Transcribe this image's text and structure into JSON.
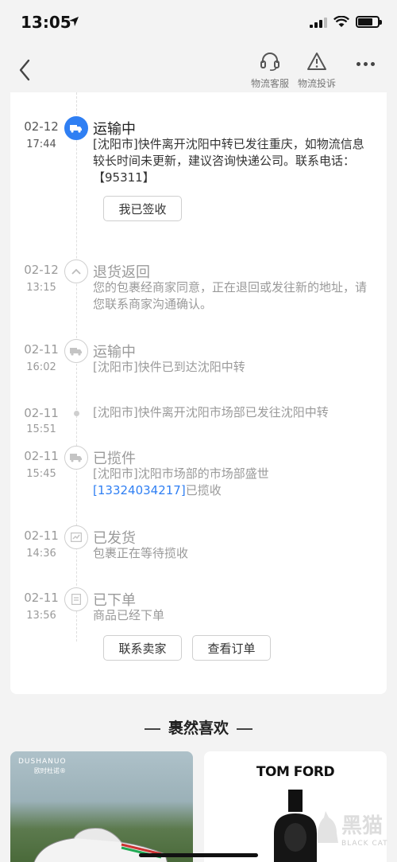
{
  "status_bar": {
    "time": "13:05"
  },
  "header": {
    "service_label": "物流客服",
    "complaint_label": "物流投诉"
  },
  "timeline": [
    {
      "date": "02-12",
      "time": "17:44",
      "status": "运输中",
      "desc": "[沈阳市]快件离开沈阳中转已发往重庆，如物流信息较长时间未更新，建议咨询快递公司。联系电话：【95311】",
      "icon": "truck-icon"
    },
    {
      "date": "02-12",
      "time": "13:15",
      "status": "退货返回",
      "desc": "您的包裹经商家同意，正在退回或发往新的地址，请您联系商家沟通确认。",
      "icon": "return-icon"
    },
    {
      "date": "02-11",
      "time": "16:02",
      "status": "运输中",
      "desc": "[沈阳市]快件已到达沈阳中转",
      "icon": "truck-icon"
    },
    {
      "date": "02-11",
      "time": "15:51",
      "status": "",
      "desc": "[沈阳市]快件离开沈阳市场部已发往沈阳中转",
      "icon": "dot"
    },
    {
      "date": "02-11",
      "time": "15:45",
      "status": "已揽件",
      "desc_prefix": "[沈阳市]沈阳市场部的市场部盛世",
      "phone": "[13324034217]",
      "desc_suffix": "已揽收",
      "icon": "pickup-icon"
    },
    {
      "date": "02-11",
      "time": "14:36",
      "status": "已发货",
      "desc": "包裹正在等待揽收",
      "icon": "shipped-icon"
    },
    {
      "date": "02-11",
      "time": "13:56",
      "status": "已下单",
      "desc": "商品已经下单",
      "icon": "order-icon"
    }
  ],
  "buttons": {
    "signed": "我已签收",
    "contact_seller": "联系卖家",
    "view_order": "查看订单"
  },
  "recommend": {
    "title": "裹然喜欢",
    "product1_brand": "DUSHANUO",
    "product1_brand_cn": "欧时杜诺®",
    "product2_brand": "TOM FORD"
  },
  "watermark": {
    "cn": "黑猫",
    "en": "BLACK CAT"
  },
  "colors": {
    "accent": "#2f7ff3"
  }
}
